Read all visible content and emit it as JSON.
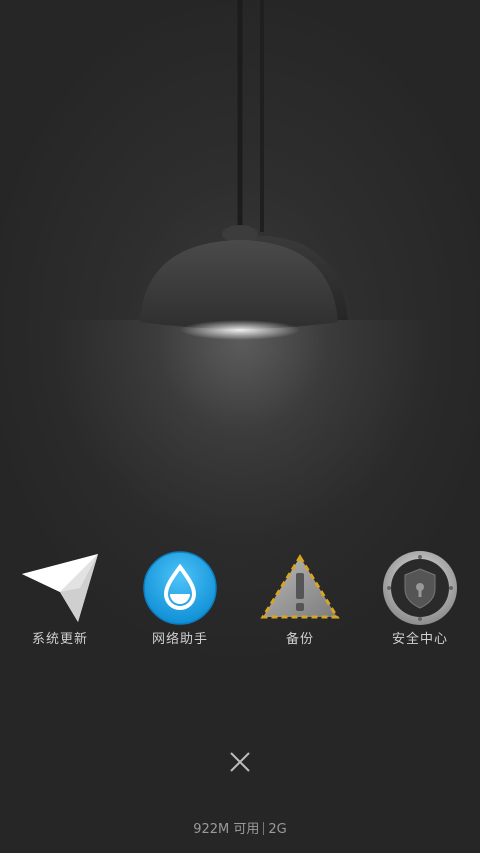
{
  "apps": [
    {
      "label": "系统更新",
      "icon": "paper-plane-icon"
    },
    {
      "label": "网络助手",
      "icon": "water-drop-icon"
    },
    {
      "label": "备份",
      "icon": "warning-triangle-icon"
    },
    {
      "label": "安全中心",
      "icon": "shield-lock-icon"
    }
  ],
  "close_icon": "close-icon",
  "memory": {
    "available": "922M 可用",
    "total": "2G"
  },
  "colors": {
    "background": "#2b2b2b",
    "label_text": "#d0d0d0",
    "network_blue": "#1fa3e6"
  }
}
